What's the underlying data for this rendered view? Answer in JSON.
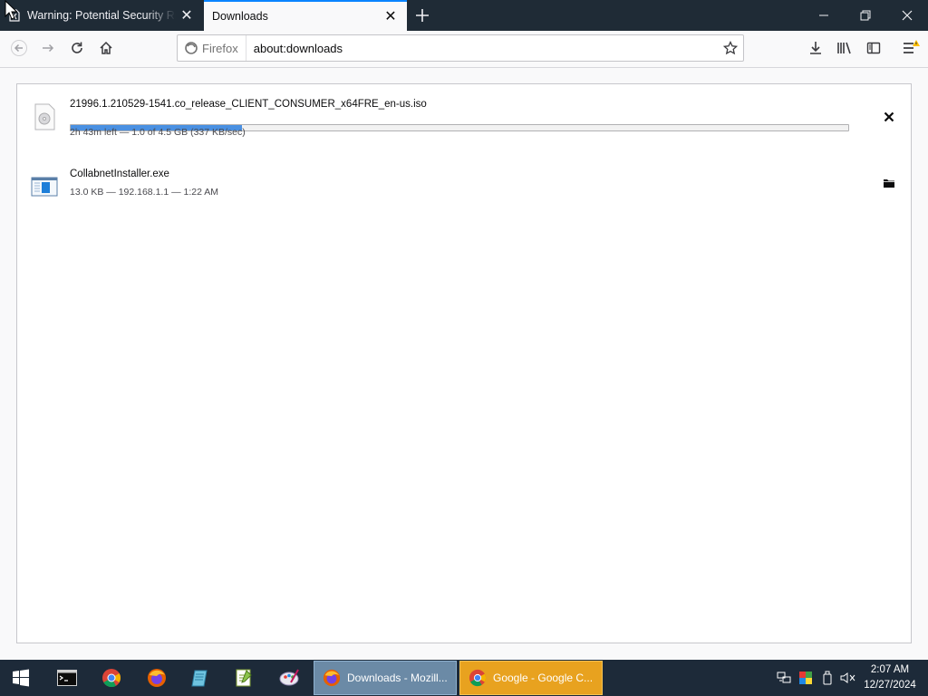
{
  "tabs": [
    {
      "title": "Warning: Potential Security Risk Ahead",
      "active": false,
      "icon": "warning-page-icon"
    },
    {
      "title": "Downloads",
      "active": true,
      "icon": null
    }
  ],
  "window_controls": {
    "minimize": "minimize",
    "restore": "restore",
    "close": "close"
  },
  "navbar": {
    "identity_label": "Firefox",
    "url": "about:downloads"
  },
  "downloads": [
    {
      "file_name": "21996.1.210529-1541.co_release_CLIENT_CONSUMER_x64FRE_en-us.iso",
      "status": "2h 43m left — 1.0 of 4.5 GB (337 KB/sec)",
      "progress": 0.22,
      "icon": "disc-image-file-icon",
      "action_icon": "cancel-icon"
    },
    {
      "file_name": "CollabnetInstaller.exe",
      "status": "13.0 KB — 192.168.1.1 — 1:22 AM",
      "icon": "executable-file-icon",
      "action_icon": "open-folder-icon"
    }
  ],
  "taskbar": {
    "pinned": [
      "start-icon",
      "terminal-icon",
      "chrome-icon",
      "firefox-icon",
      "notepad-icon",
      "editor-icon",
      "paint-icon"
    ],
    "tasks": [
      {
        "label": "Downloads - Mozill...",
        "icon": "firefox-icon",
        "active": true
      },
      {
        "label": "Google - Google C...",
        "icon": "chrome-icon",
        "active": false
      }
    ],
    "clock": {
      "time": "2:07 AM",
      "date": "12/27/2024"
    }
  },
  "colors": {
    "accent": "#0a84ff",
    "progress_fill": "#4a90e2",
    "taskbar": "#1d2a39",
    "task_firefox": "#6b8aa6",
    "task_chrome": "#e8a21f"
  }
}
